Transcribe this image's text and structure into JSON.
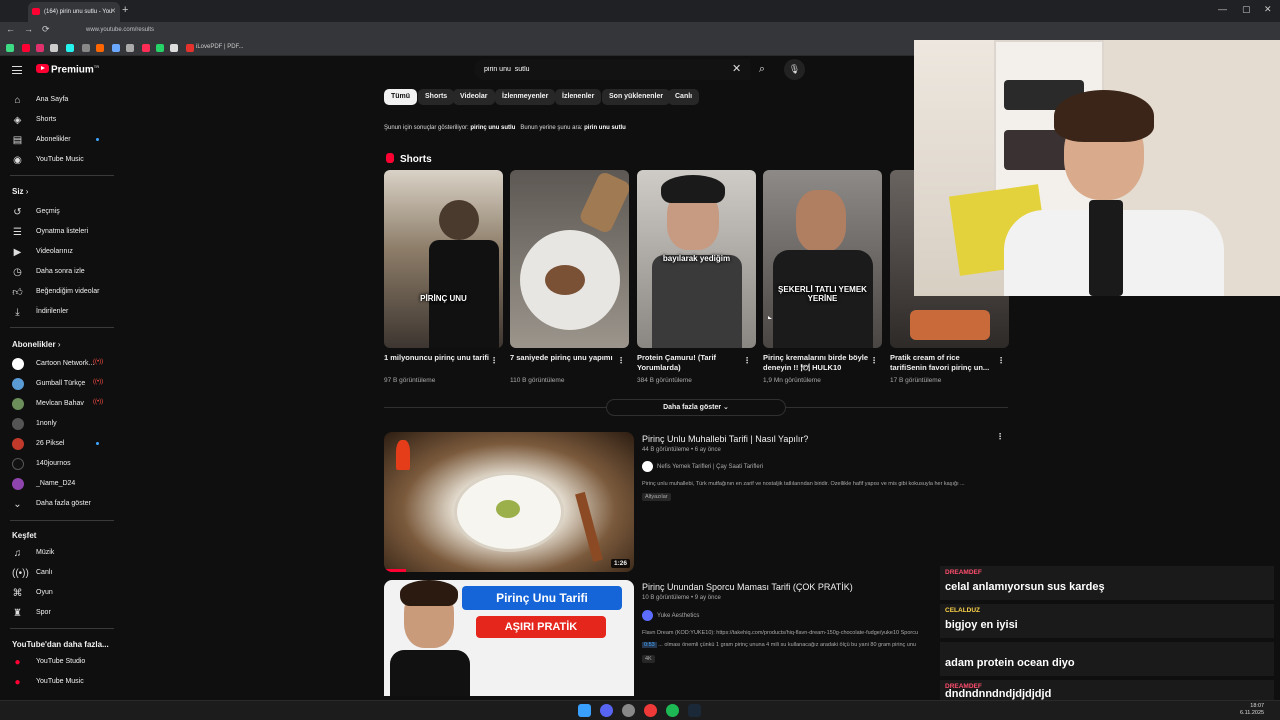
{
  "browser": {
    "tab_title": "(164) pirin unu sutlu - You",
    "url": "www.youtube.com/results",
    "bookmark_label": "iLovePDF | PDF..."
  },
  "sidebar": {
    "logo": "Premium",
    "logo_sup": "TR",
    "main": [
      {
        "label": "Ana Sayfa",
        "icon": "home-icon"
      },
      {
        "label": "Shorts",
        "icon": "shorts-icon"
      },
      {
        "label": "Abonelikler",
        "icon": "subscriptions-icon"
      },
      {
        "label": "YouTube Music",
        "icon": "music-icon"
      }
    ],
    "you_title": "Siz",
    "you": [
      {
        "label": "Geçmiş",
        "icon": "history-icon"
      },
      {
        "label": "Oynatma listeleri",
        "icon": "playlist-icon"
      },
      {
        "label": "Videolarınız",
        "icon": "your-videos-icon"
      },
      {
        "label": "Daha sonra izle",
        "icon": "watch-later-icon"
      },
      {
        "label": "Beğendiğim videolar",
        "icon": "like-icon"
      },
      {
        "label": "İndirilenler",
        "icon": "download-icon"
      }
    ],
    "subs_title": "Abonelikler",
    "subs": [
      {
        "label": "Cartoon Network...",
        "status": "live",
        "color": "#222222"
      },
      {
        "label": "Gumball Türkçe",
        "status": "live",
        "color": "#5a9bd4"
      },
      {
        "label": "Mevlcan Bahav",
        "status": "live",
        "color": "#6b8e5a"
      },
      {
        "label": "1nonly",
        "status": "",
        "color": "#555555"
      },
      {
        "label": "26 Piksel",
        "status": "new",
        "color": "#c0392b"
      },
      {
        "label": "140journos",
        "status": "",
        "color": "#111111"
      },
      {
        "label": "_Name_D24",
        "status": "",
        "color": "#8e44ad"
      }
    ],
    "show_more": "Daha fazla göster",
    "explore_title": "Keşfet",
    "explore": [
      {
        "label": "Müzik",
        "icon": "music-note-icon"
      },
      {
        "label": "Canlı",
        "icon": "live-icon"
      },
      {
        "label": "Oyun",
        "icon": "gaming-icon"
      },
      {
        "label": "Spor",
        "icon": "trophy-icon"
      }
    ],
    "more_title": "YouTube'dan daha fazla...",
    "more": [
      {
        "label": "YouTube Studio"
      },
      {
        "label": "YouTube Music"
      }
    ]
  },
  "search": {
    "query": "pirin unu  sutlu"
  },
  "chips": [
    "Tümü",
    "Shorts",
    "Videolar",
    "İzlenmeyenler",
    "İzlenenler",
    "Son yüklenenler",
    "Canlı"
  ],
  "spell": {
    "prefix": "Şunun için sonuçlar gösteriliyor:",
    "corrected": "pirinç unu sutlu",
    "instead": "Bunun yerine şunu ara:",
    "original": "pirin unu sutlu"
  },
  "shorts": {
    "title": "Shorts",
    "items": [
      {
        "title": "1 milyonuncu pirinç unu tarifi",
        "views": "97 B görüntüleme",
        "caption": "PİRİNÇ UNU",
        "bg": "#7a6a58"
      },
      {
        "title": "7 saniyede pirinç unu yapımı",
        "views": "110 B görüntüleme",
        "caption": "",
        "bg": "#8d8a84"
      },
      {
        "title": "Protein Çamuru! (Tarif Yorumlarda)",
        "views": "384 B görüntüleme",
        "caption": "bayılarak yediğim",
        "bg": "#9a9590"
      },
      {
        "title": "Pirinç kremalarını birde böyle deneyin !! 🍽 HULK10",
        "views": "1,9 Mn görüntüleme",
        "caption": "ŞEKERLİ TATLI YEMEK YERİNE",
        "bg": "#6e6a66"
      },
      {
        "title": "Pratik cream of rice tarifiSenin favori pirinç un...",
        "views": "17 B görüntüleme",
        "caption": "",
        "bg": "#4a4542"
      }
    ],
    "show_more": "Daha fazla göster"
  },
  "videos": [
    {
      "title": "Pirinç Unlu Muhallebi Tarifi | Nasıl Yapılır?",
      "meta": "44 B görüntüleme • 6 ay önce",
      "channel": "Nefis Yemek Tarifleri | Çay Saati Tarifleri",
      "description": "Pirinç unlu muhallebi, Türk mutfağının en zarif ve nostaljik tatlılarından biridir. Özellikle hafif yapısı ve mis gibi kokusuyla her kaşığı ...",
      "badge": "Altyazılar",
      "duration": "1:26"
    },
    {
      "title": "Pirinç Unundan Sporcu Maması Tarifi (ÇOK PRATİK)",
      "meta": "10 B görüntüleme • 9 ay önce",
      "channel": "Yuke Aesthetics",
      "description": "Flavn Dream (KOD:YUKE10): https://takehiq.com/products/hiq-flavn-dream-150g-chocolate-fudge/yuke10 Sporcu",
      "chapter_time": "0:53",
      "chapter_text": "... olması önemli çünkü 1 gram pirinç ununa 4 mili su kullanacağız aradaki ölçü bu yani 80 gram pirinç unu",
      "badge": "4K",
      "thumb_line1": "Pirinç Unu Tarifi",
      "thumb_line2": "AŞIRI PRATİK"
    }
  ],
  "chat": [
    {
      "name": "DREAMDEF",
      "text": "celal anlamıyorsun sus kardeş",
      "color": "#ff4d6d"
    },
    {
      "name": "CELALDUZ",
      "text": "bigjoy en iyisi",
      "color": "#ffd54a"
    },
    {
      "name": "",
      "text": "adam protein ocean diyo",
      "color": "#ffffff"
    },
    {
      "name": "DREAMDEF",
      "text": "dndndnndndjdjdjdjd",
      "color": "#ff4d6d"
    }
  ],
  "clock": {
    "time": "18:07",
    "date": "6.11.2025"
  }
}
